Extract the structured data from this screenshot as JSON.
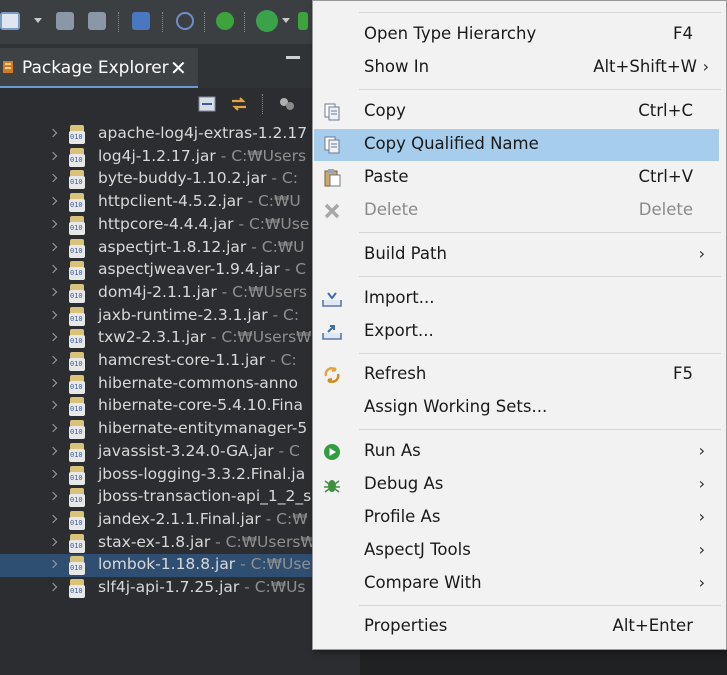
{
  "view": {
    "tab_label": "Package Explorer",
    "close_glyph": "✕"
  },
  "tree": {
    "rows": [
      {
        "name": "apache-log4j-extras-1.2.17",
        "path": ""
      },
      {
        "name": "log4j-1.2.17.jar",
        "path": " - C:₩Users"
      },
      {
        "name": "byte-buddy-1.10.2.jar",
        "path": " - C:"
      },
      {
        "name": "httpclient-4.5.2.jar",
        "path": " - C:₩U"
      },
      {
        "name": "httpcore-4.4.4.jar",
        "path": " - C:₩Use"
      },
      {
        "name": "aspectjrt-1.8.12.jar",
        "path": " - C:₩U"
      },
      {
        "name": "aspectjweaver-1.9.4.jar",
        "path": " - C"
      },
      {
        "name": "dom4j-2.1.1.jar",
        "path": " - C:₩Users"
      },
      {
        "name": "jaxb-runtime-2.3.1.jar",
        "path": " - C:"
      },
      {
        "name": "txw2-2.3.1.jar",
        "path": " - C:₩Users₩"
      },
      {
        "name": "hamcrest-core-1.1.jar",
        "path": " - C:"
      },
      {
        "name": "hibernate-commons-anno",
        "path": ""
      },
      {
        "name": "hibernate-core-5.4.10.Fina",
        "path": ""
      },
      {
        "name": "hibernate-entitymanager-5",
        "path": ""
      },
      {
        "name": "javassist-3.24.0-GA.jar",
        "path": " - C"
      },
      {
        "name": "jboss-logging-3.3.2.Final.ja",
        "path": ""
      },
      {
        "name": "jboss-transaction-api_1_2_s",
        "path": ""
      },
      {
        "name": "jandex-2.1.1.Final.jar",
        "path": " - C:₩"
      },
      {
        "name": "stax-ex-1.8.jar",
        "path": " - C:₩Users₩"
      },
      {
        "name": "lombok-1.18.8.jar",
        "path": " - C:₩User"
      },
      {
        "name": "slf4j-api-1.7.25.jar",
        "path": " - C:₩Us"
      }
    ]
  },
  "menu": {
    "items": [
      {
        "label": "Open Type Hierarchy",
        "shortcut": "F4",
        "submenu": false
      },
      {
        "label": "Show In",
        "shortcut": "Alt+Shift+W",
        "submenu": true
      },
      {
        "label": "Copy",
        "shortcut": "Ctrl+C",
        "submenu": false
      },
      {
        "label": "Copy Qualified Name",
        "shortcut": "",
        "submenu": false
      },
      {
        "label": "Paste",
        "shortcut": "Ctrl+V",
        "submenu": false
      },
      {
        "label": "Delete",
        "shortcut": "Delete",
        "submenu": false
      },
      {
        "label": "Build Path",
        "shortcut": "",
        "submenu": true
      },
      {
        "label": "Import...",
        "shortcut": "",
        "submenu": false
      },
      {
        "label": "Export...",
        "shortcut": "",
        "submenu": false
      },
      {
        "label": "Refresh",
        "shortcut": "F5",
        "submenu": false
      },
      {
        "label": "Assign Working Sets...",
        "shortcut": "",
        "submenu": false
      },
      {
        "label": "Run As",
        "shortcut": "",
        "submenu": true
      },
      {
        "label": "Debug As",
        "shortcut": "",
        "submenu": true
      },
      {
        "label": "Profile As",
        "shortcut": "",
        "submenu": true
      },
      {
        "label": "AspectJ Tools",
        "shortcut": "",
        "submenu": true
      },
      {
        "label": "Compare With",
        "shortcut": "",
        "submenu": true
      },
      {
        "label": "Properties",
        "shortcut": "Alt+Enter",
        "submenu": false
      }
    ],
    "submenu_glyph": "›",
    "highlighted": "Copy Qualified Name",
    "disabled": "Delete"
  },
  "colors": {
    "menu_highlight": "#a6cdec",
    "selected_row": "#2f4f72",
    "tab_accent": "#6a9ad0"
  }
}
